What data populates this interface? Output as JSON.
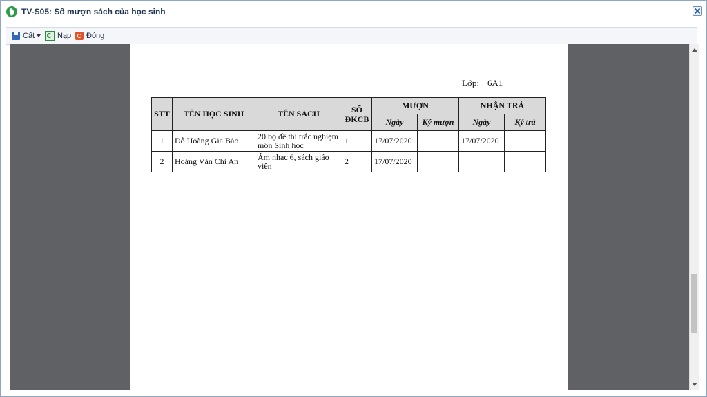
{
  "window": {
    "title": "TV-S05: Sổ mượn sách của học sinh"
  },
  "toolbar": {
    "save_label": "Cất",
    "reload_label": "Nạp",
    "close_label": "Đóng"
  },
  "report": {
    "class_label": "Lớp:",
    "class_value": "6A1",
    "headers": {
      "stt": "STT",
      "student_name": "TÊN HỌC SINH",
      "book_name": "TÊN SÁCH",
      "dkcb": "SỐ ĐKCB",
      "borrow": "MƯỢN",
      "return": "NHẬN TRẢ",
      "borrow_date": "Ngày",
      "borrow_sign": "Ký mượn",
      "return_date": "Ngày",
      "return_sign": "Ký trả"
    },
    "rows": [
      {
        "stt": "1",
        "student": "Đỗ Hoàng Gia Bảo",
        "book": "20 bộ đề thi trắc nghiệm môn Sinh học",
        "dkcb": "1",
        "borrow_date": "17/07/2020",
        "borrow_sign": "",
        "return_date": "17/07/2020",
        "return_sign": ""
      },
      {
        "stt": "2",
        "student": "Hoàng Văn Chi An",
        "book": "Âm nhạc 6, sách giáo viên",
        "dkcb": "2",
        "borrow_date": "17/07/2020",
        "borrow_sign": "",
        "return_date": "",
        "return_sign": ""
      }
    ]
  }
}
